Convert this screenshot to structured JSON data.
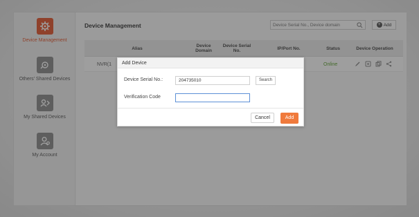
{
  "sidebar": {
    "items": [
      {
        "label": "Device Management",
        "icon": "gear-icon",
        "active": true
      },
      {
        "label": "Others' Shared Devices",
        "icon": "shared-devices-icon",
        "active": false
      },
      {
        "label": "My Shared Devices",
        "icon": "my-shared-icon",
        "active": false
      },
      {
        "label": "My Account",
        "icon": "account-icon",
        "active": false
      }
    ]
  },
  "header": {
    "title": "Device Management",
    "search_placeholder": "Device Serial No., Device domain",
    "add_label": "Add"
  },
  "table": {
    "columns": [
      "Alias",
      "Device Domain",
      "Device Serial No.",
      "IP/Port No.",
      "Status",
      "Device Operation"
    ],
    "rows": [
      {
        "alias": "NVR(1",
        "status": "Online"
      }
    ]
  },
  "dialog": {
    "title": "Add Device",
    "serial_label": "Device Serial No.:",
    "serial_value": "204735010",
    "search_label": "Search",
    "verification_label": "Verification Code",
    "verification_value": "",
    "cancel_label": "Cancel",
    "add_label": "Add"
  },
  "colors": {
    "accent": "#e4572e",
    "add_button": "#f07a3c",
    "status_online": "#5aa02c"
  }
}
